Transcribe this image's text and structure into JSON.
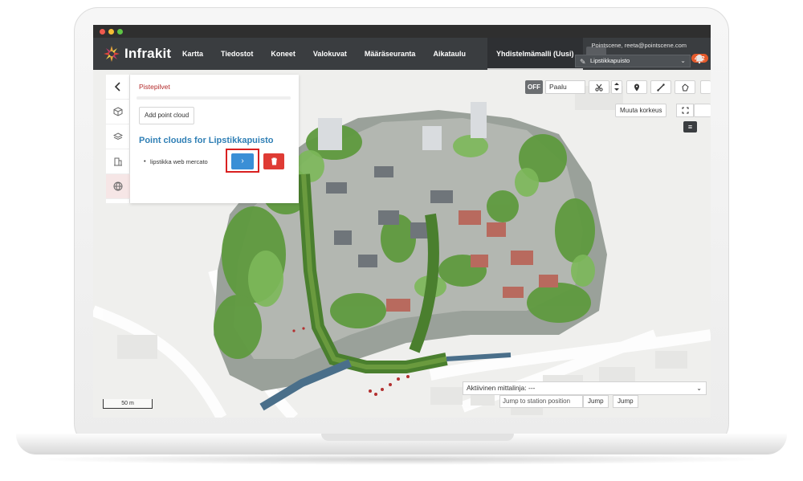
{
  "app": {
    "brand": "Infrakit",
    "user": "Pointscene, reeta@pointscene.com",
    "notifications": "402",
    "project": "Lipstikkapuisto"
  },
  "nav": {
    "items": [
      "Kartta",
      "Tiedostot",
      "Koneet",
      "Valokuvat",
      "Määräseuranta",
      "Aikataulu",
      "Yhdistelmämalli (Uusi)"
    ],
    "more": "...",
    "active": "Yhdistelmämalli (Uusi)"
  },
  "panel": {
    "title": "Pistepilvet",
    "add_button": "Add point cloud",
    "heading": "Point clouds for Lipstikkapuisto",
    "items": [
      "lipstikka web mercato"
    ],
    "go_label": "›",
    "delete_label": "🗑"
  },
  "toolbar": {
    "toggle": "OFF",
    "pile_input_value": "Paalu",
    "change_height": "Muuta korkeus",
    "layers_label": "≡"
  },
  "bottom": {
    "alignment_label": "Aktiivinen mittalinja: ---",
    "station_placeholder": "Jump to station position",
    "jump1": "Jump",
    "jump2": "Jump",
    "scale": "50 m"
  },
  "colors": {
    "header": "#3a3d40",
    "accent_blue": "#3a8fd6",
    "danger_red": "#df3b34",
    "heading_blue": "#2f7fb5",
    "badge": "#e55a2b"
  }
}
